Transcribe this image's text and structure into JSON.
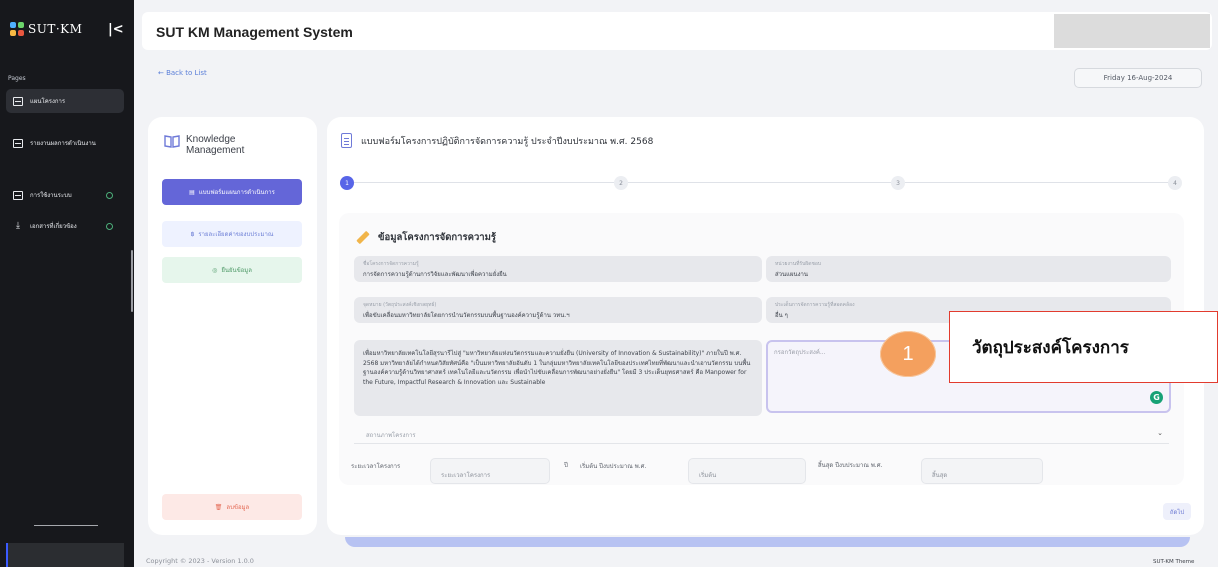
{
  "app": {
    "logo_text": "SUT·KM",
    "title": "SUT KM Management System"
  },
  "sidebar": {
    "section_label": "Pages",
    "items": [
      {
        "label": "แผนโครงการ",
        "icon": "table-icon"
      },
      {
        "label": "รายงานผลการดำเนินงาน",
        "icon": "list-icon"
      },
      {
        "label": "การใช้งานระบบ",
        "icon": "table-icon"
      },
      {
        "label": "เอกสารที่เกี่ยวข้อง",
        "icon": "download-icon"
      }
    ]
  },
  "topbar": {
    "back_label": "← Back to List",
    "date": "Friday 16-Aug-2024"
  },
  "left_panel": {
    "heading": "Knowledge Management",
    "buttons": {
      "plan_form": "แบบฟอร์มแผนการดำเนินการ",
      "budget": "รายละเอียดค่าของบประมาณ",
      "confirm": "ยืนยันข้อมูล",
      "delete": "ลบข้อมูล"
    }
  },
  "form": {
    "title": "แบบฟอร์มโครงการปฏิบัติการจัดการความรู้ ประจำปีงบประมาณ พ.ศ. 2568",
    "steps": [
      "1",
      "2",
      "3",
      "4"
    ],
    "section_title": "ข้อมูลโครงการจัดการความรู้",
    "fields": {
      "project_name_label": "ชื่อโครงการจัดการความรู้",
      "project_name_value": "การจัดการความรู้ด้านการวิจัยและพัฒนาเพื่อความยั่งยืน",
      "unit_label": "หน่วยงานที่รับผิดชอบ",
      "unit_value": "ส่วนแผนงาน",
      "goal_label": "จุดหมาย (วัตถุประสงค์เชิงกลยุทธ์)",
      "goal_value": "เพื่อขับเคลื่อนมหาวิทยาลัยโดยการนำนวัตกรรมบนพื้นฐานองค์ความรู้ด้าน  วทน.ฯ",
      "km_type_label": "ประเด็นการจัดการความรู้ที่สอดคล้อง",
      "km_type_value": "อื่น ๆ",
      "description": "เพื่อมหาวิทยาลัยเทคโนโลยีสุรนารีไปสู่ \"มหาวิทยาลัยแห่งนวัตกรรมและความยั่งยืน (University of Innovation & Sustainability)\" ภายในปี พ.ศ. 2568 มหาวิทยาลัยได้กำหนดวิสัยทัศน์คือ \"เป็นมหาวิทยาลัยอันดับ 1 ในกลุ่มมหาวิทยาลัยเทคโนโลยีของประเทศไทยที่พัฒนาและนำเอานวัตกรรม บนพื้นฐานองค์ความรู้ด้านวิทยาศาสตร์ เทคโนโลยีและนวัตกรรม เพื่อนำไปขับเคลื่อนการพัฒนาอย่างยั่งยืน\" โดยมี 3 ประเด็นยุทธศาสตร์ คือ Manpower for the Future, Impactful Research & Innovation และ Sustainable",
      "objective_placeholder": "กรอกวัตถุประสงค์...",
      "status_placeholder": "สถานภาพโครงการ",
      "duration_label": "ระยะเวลาโครงการ",
      "duration_placeholder": "ระยะเวลาโครงการ",
      "year_unit": "ปี",
      "start_label": "เริ่มต้น ปีงบประมาณ พ.ศ.",
      "start_placeholder": "เริ่มต้น",
      "end_label": "สิ้นสุด ปีงบประมาณ พ.ศ.",
      "end_placeholder": "สิ้นสุด"
    },
    "next_label": "ถัดไป"
  },
  "callout": {
    "number": "1",
    "text": "วัตถุประสงค์โครงการ"
  },
  "footer": {
    "copyright": "Copyright © 2023 - Version 1.0.0",
    "theme": "SUT-KM Theme"
  },
  "colors": {
    "primary": "#6466d8",
    "sidebar_bg": "#17181c",
    "callout_orange": "#f4a05e",
    "callout_border": "#e23b2e"
  }
}
